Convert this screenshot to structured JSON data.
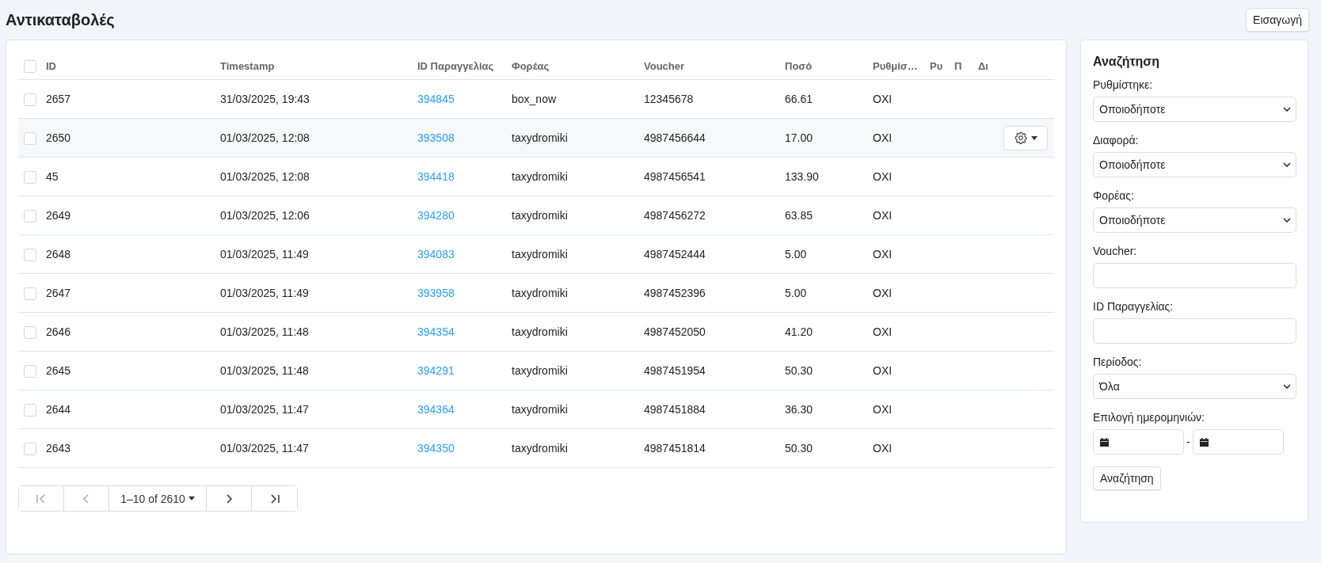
{
  "page": {
    "title": "Αντικαταβολές",
    "import_button": "Εισαγωγή"
  },
  "table": {
    "select_all": {
      "checked": false
    },
    "columns": [
      "ID",
      "Timestamp",
      "ID Παραγγελίας",
      "Φορέας",
      "Voucher",
      "Ποσό",
      "Ρυθμίσ…",
      "Ρυ",
      "Π",
      "Δι"
    ],
    "rows": [
      {
        "checked": false,
        "hovered": false,
        "cells": [
          "2657",
          "31/03/2025, 19:43",
          "394845",
          "box_now",
          "12345678",
          "66.61",
          "OXI"
        ]
      },
      {
        "checked": false,
        "hovered": true,
        "cells": [
          "2650",
          "01/03/2025, 12:08",
          "393508",
          "taxydromiki",
          "4987456644",
          "17.00",
          "OXI"
        ]
      },
      {
        "checked": false,
        "hovered": false,
        "cells": [
          "45",
          "01/03/2025, 12:08",
          "394418",
          "taxydromiki",
          "4987456541",
          "133.90",
          "OXI"
        ]
      },
      {
        "checked": false,
        "hovered": false,
        "cells": [
          "2649",
          "01/03/2025, 12:06",
          "394280",
          "taxydromiki",
          "4987456272",
          "63.85",
          "OXI"
        ]
      },
      {
        "checked": false,
        "hovered": false,
        "cells": [
          "2648",
          "01/03/2025, 11:49",
          "394083",
          "taxydromiki",
          "4987452444",
          "5.00",
          "OXI"
        ]
      },
      {
        "checked": false,
        "hovered": false,
        "cells": [
          "2647",
          "01/03/2025, 11:49",
          "393958",
          "taxydromiki",
          "4987452396",
          "5.00",
          "OXI"
        ]
      },
      {
        "checked": false,
        "hovered": false,
        "cells": [
          "2646",
          "01/03/2025, 11:48",
          "394354",
          "taxydromiki",
          "4987452050",
          "41.20",
          "OXI"
        ]
      },
      {
        "checked": false,
        "hovered": false,
        "cells": [
          "2645",
          "01/03/2025, 11:48",
          "394291",
          "taxydromiki",
          "4987451954",
          "50.30",
          "OXI"
        ]
      },
      {
        "checked": false,
        "hovered": false,
        "cells": [
          "2644",
          "01/03/2025, 11:47",
          "394364",
          "taxydromiki",
          "4987451884",
          "36.30",
          "OXI"
        ]
      },
      {
        "checked": false,
        "hovered": false,
        "cells": [
          "2643",
          "01/03/2025, 11:47",
          "394350",
          "taxydromiki",
          "4987451814",
          "50.30",
          "OXI"
        ]
      }
    ],
    "pagination": {
      "range": "1–10 of 2610",
      "first_disabled": true,
      "prev_disabled": true,
      "next_disabled": false,
      "last_disabled": false
    }
  },
  "search_panel": {
    "title": "Αναζήτηση",
    "fields": [
      {
        "kind": "select",
        "label": "Ρυθμίστηκε:",
        "value": "Οποιοδήποτε"
      },
      {
        "kind": "select",
        "label": "Διαφορά:",
        "value": "Οποιοδήποτε"
      },
      {
        "kind": "select",
        "label": "Φορέας:",
        "value": "Οποιοδήποτε"
      },
      {
        "kind": "text",
        "label": "Voucher:"
      },
      {
        "kind": "text",
        "label": "ID Παραγγελίας:"
      },
      {
        "kind": "select",
        "label": "Περίοδος:",
        "value": "Όλα"
      },
      {
        "kind": "daterange",
        "label": "Επιλογή ημερομηνιών:",
        "separator": "-"
      }
    ],
    "button": "Αναζήτηση"
  }
}
